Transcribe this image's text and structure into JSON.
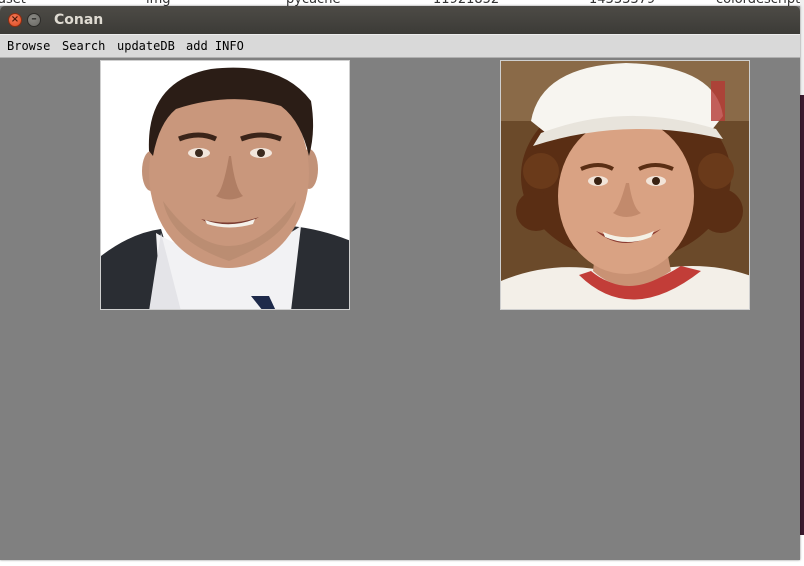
{
  "background": {
    "items": [
      "aset",
      "img",
      "pycache",
      "11921852",
      "14333379",
      "colordescript"
    ]
  },
  "window": {
    "title": "Conan"
  },
  "menu": {
    "items": [
      "Browse",
      "Search",
      "updateDB",
      "add INFO"
    ]
  },
  "colors": {
    "window_background": "#808080",
    "titlebar": "#3c3b37",
    "menubar": "#d9d9d9",
    "close_button": "#e2542a"
  },
  "images": {
    "left": {
      "subject": "adult man in dark suit jacket and white shirt, smiling, white background"
    },
    "right": {
      "subject": "young boy with curly brown hair wearing white cap and red-collared shirt, smiling"
    }
  }
}
